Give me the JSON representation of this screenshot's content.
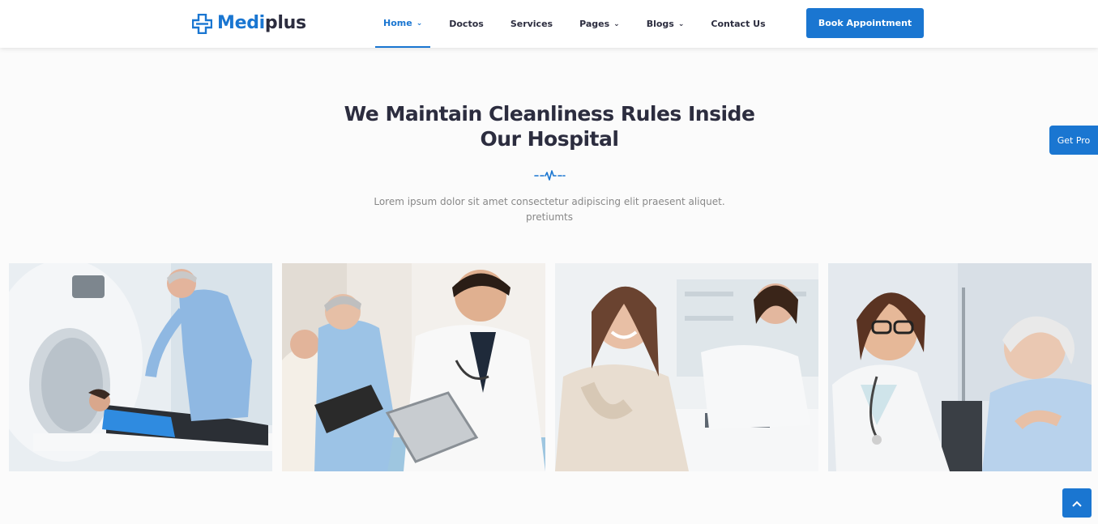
{
  "brand": {
    "name_part1": "Medi",
    "name_part2": "plus",
    "accent_color": "#1a76d1",
    "dark_color": "#2c2d3f"
  },
  "nav": {
    "items": [
      {
        "label": "Home",
        "active": true,
        "has_dropdown": true
      },
      {
        "label": "Doctos",
        "active": false,
        "has_dropdown": false
      },
      {
        "label": "Services",
        "active": false,
        "has_dropdown": false
      },
      {
        "label": "Pages",
        "active": false,
        "has_dropdown": true
      },
      {
        "label": "Blogs",
        "active": false,
        "has_dropdown": true
      },
      {
        "label": "Contact Us",
        "active": false,
        "has_dropdown": false
      }
    ]
  },
  "header": {
    "cta_label": "Book Appointment"
  },
  "section": {
    "title_line1": "We Maintain Cleanliness Rules Inside",
    "title_line2": "Our Hospital",
    "description_line1": "Lorem ipsum dolor sit amet consectetur adipiscing elit praesent aliquet.",
    "description_line2": "pretiumts"
  },
  "side_tab": {
    "label": "Get Pro"
  },
  "gallery": {
    "photos": [
      {
        "name": "mri-scan-photo"
      },
      {
        "name": "doctors-with-tablet-photo"
      },
      {
        "name": "smiling-patient-doctor-photo"
      },
      {
        "name": "doctor-elderly-patient-photo"
      }
    ]
  },
  "icons": {
    "divider": "heartbeat-line-icon",
    "scroll_top": "chevron-up-icon",
    "logo": "medical-cross-icon"
  }
}
